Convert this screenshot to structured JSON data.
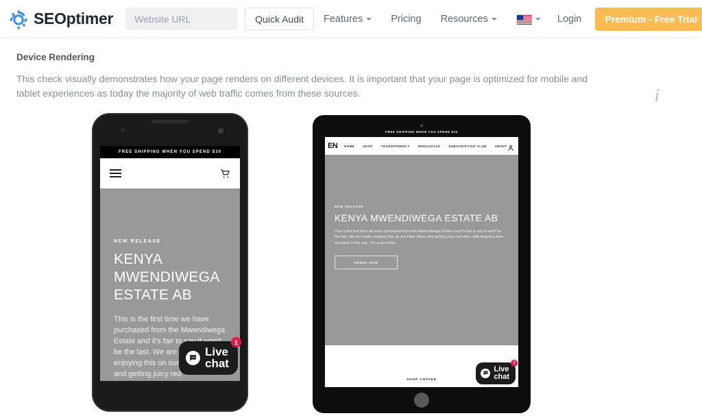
{
  "header": {
    "brand": {
      "seo": "SEO",
      "optimer": "ptimer",
      "logo_icon": "gear-refresh-icon"
    },
    "url_input": {
      "placeholder": "Website URL",
      "value": ""
    },
    "quick_audit_label": "Quick Audit",
    "nav": [
      {
        "label": "Features",
        "has_caret": true
      },
      {
        "label": "Pricing",
        "has_caret": false
      },
      {
        "label": "Resources",
        "has_caret": true
      }
    ],
    "language": {
      "flag": "us-flag-icon",
      "has_caret": true
    },
    "login_label": "Login",
    "premium_label": "Premium - Free Trial",
    "premium_color": "#f9bb52"
  },
  "section": {
    "title": "Device Rendering",
    "description": "This check visually demonstrates how your page renders on different devices. It is important that your page is optimized for mobile and tablet experiences as today the majority of web traffic comes from these sources.",
    "info_icon": "info-icon",
    "info_glyph": "i"
  },
  "phone": {
    "shipping_bar": "FREE SHIPPING WHEN YOU SPEND $30",
    "menu_icon": "hamburger-menu-icon",
    "cart_icon": "shopping-cart-icon",
    "hero": {
      "kicker": "NEW RELEASE",
      "title": "KENYA MWENDIWEGA ESTATE AB",
      "body": "This is the first time we have purchased from the Mwendiwega Estate and it's fair to say it won't be the last. We are really enjoying this on our Filter Menu and getting juicy red",
      "background_color": "#999999"
    },
    "live_chat": {
      "line1": "Live",
      "line2": "chat",
      "badge": "1",
      "badge_color": "#e8174a",
      "icon": "chat-bubble-icon"
    }
  },
  "tablet": {
    "shipping_bar": "FREE SHIPPING WHEN YOU SPEND $30",
    "language_label": "EN",
    "nav_links": [
      "HOME",
      "SHOP",
      "TRANSPARENCY",
      "WHOLESALE",
      "SUBSCRIPTION CLUB",
      "ABOUT"
    ],
    "account_icon": "user-account-icon",
    "hero": {
      "kicker": "NEW RELEASE",
      "title": "KENYA MWENDIWEGA ESTATE AB",
      "body": "This is the first time we have purchased from the Mwendiwega Estate and it's fair to say it won't be the last. We are really enjoying this on our Filter Menu and getting juicy red wine, with lingering lime and pear in the cup - It's a nice time.",
      "cta_label": "ORDER NOW",
      "background_color": "#999999"
    },
    "footer_text": "SHOP COFFEE",
    "live_chat": {
      "line1": "Live",
      "line2": "chat",
      "badge": "1",
      "badge_color": "#e8174a",
      "icon": "chat-bubble-icon"
    }
  }
}
